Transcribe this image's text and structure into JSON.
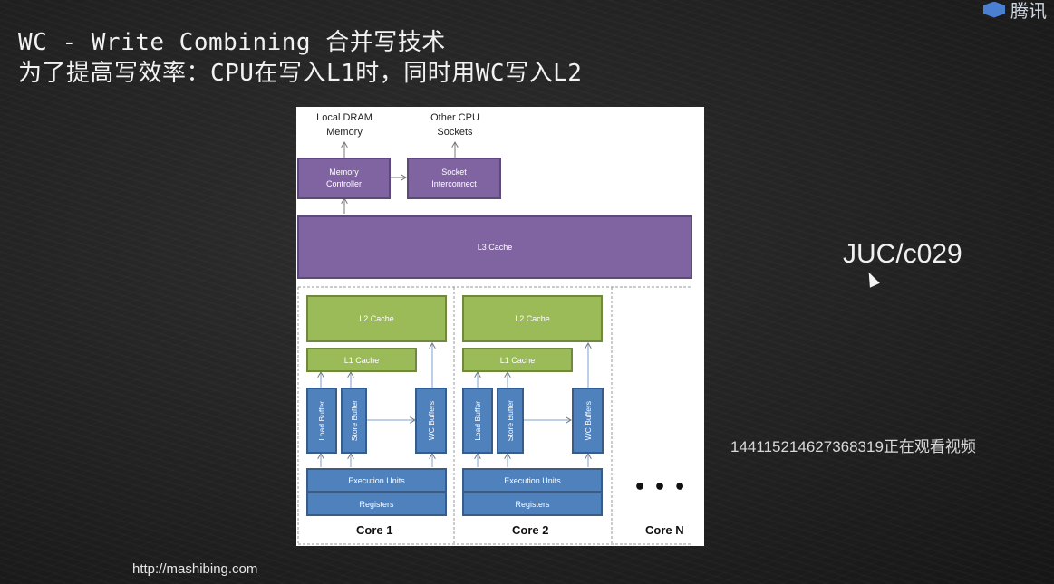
{
  "title": {
    "line1": "WC - Write Combining 合并写技术",
    "line2": "为了提高写效率：CPU在写入L1时，同时用WC写入L2"
  },
  "logo": {
    "text": "腾讯"
  },
  "side_note": "JUC/c029",
  "viewer_text": "14411521462736831­9正在观看视频",
  "site_url": "http://mashibing.com",
  "diagram": {
    "top_labels": {
      "dram": "Local DRAM\nMemory",
      "other_cpu": "Other CPU\nSockets"
    },
    "memory_controller": "Memory\nController",
    "socket_interconnect": "Socket\nInterconnect",
    "l3": "L3 Cache",
    "cores": [
      {
        "name": "Core 1",
        "l2": "L2 Cache",
        "l1": "L1 Cache",
        "load": "Load Buffer",
        "store": "Store Buffer",
        "wc": "WC Buffers",
        "exec": "Execution Units",
        "regs": "Registers"
      },
      {
        "name": "Core 2",
        "l2": "L2 Cache",
        "l1": "L1 Cache",
        "load": "Load Buffer",
        "store": "Store Buffer",
        "wc": "WC Buffers",
        "exec": "Execution Units",
        "regs": "Registers"
      }
    ],
    "core_n": "Core N",
    "dots": "•••"
  },
  "colors": {
    "purple": "#8064a2",
    "green": "#9bbb59",
    "blue": "#4f81bd"
  }
}
